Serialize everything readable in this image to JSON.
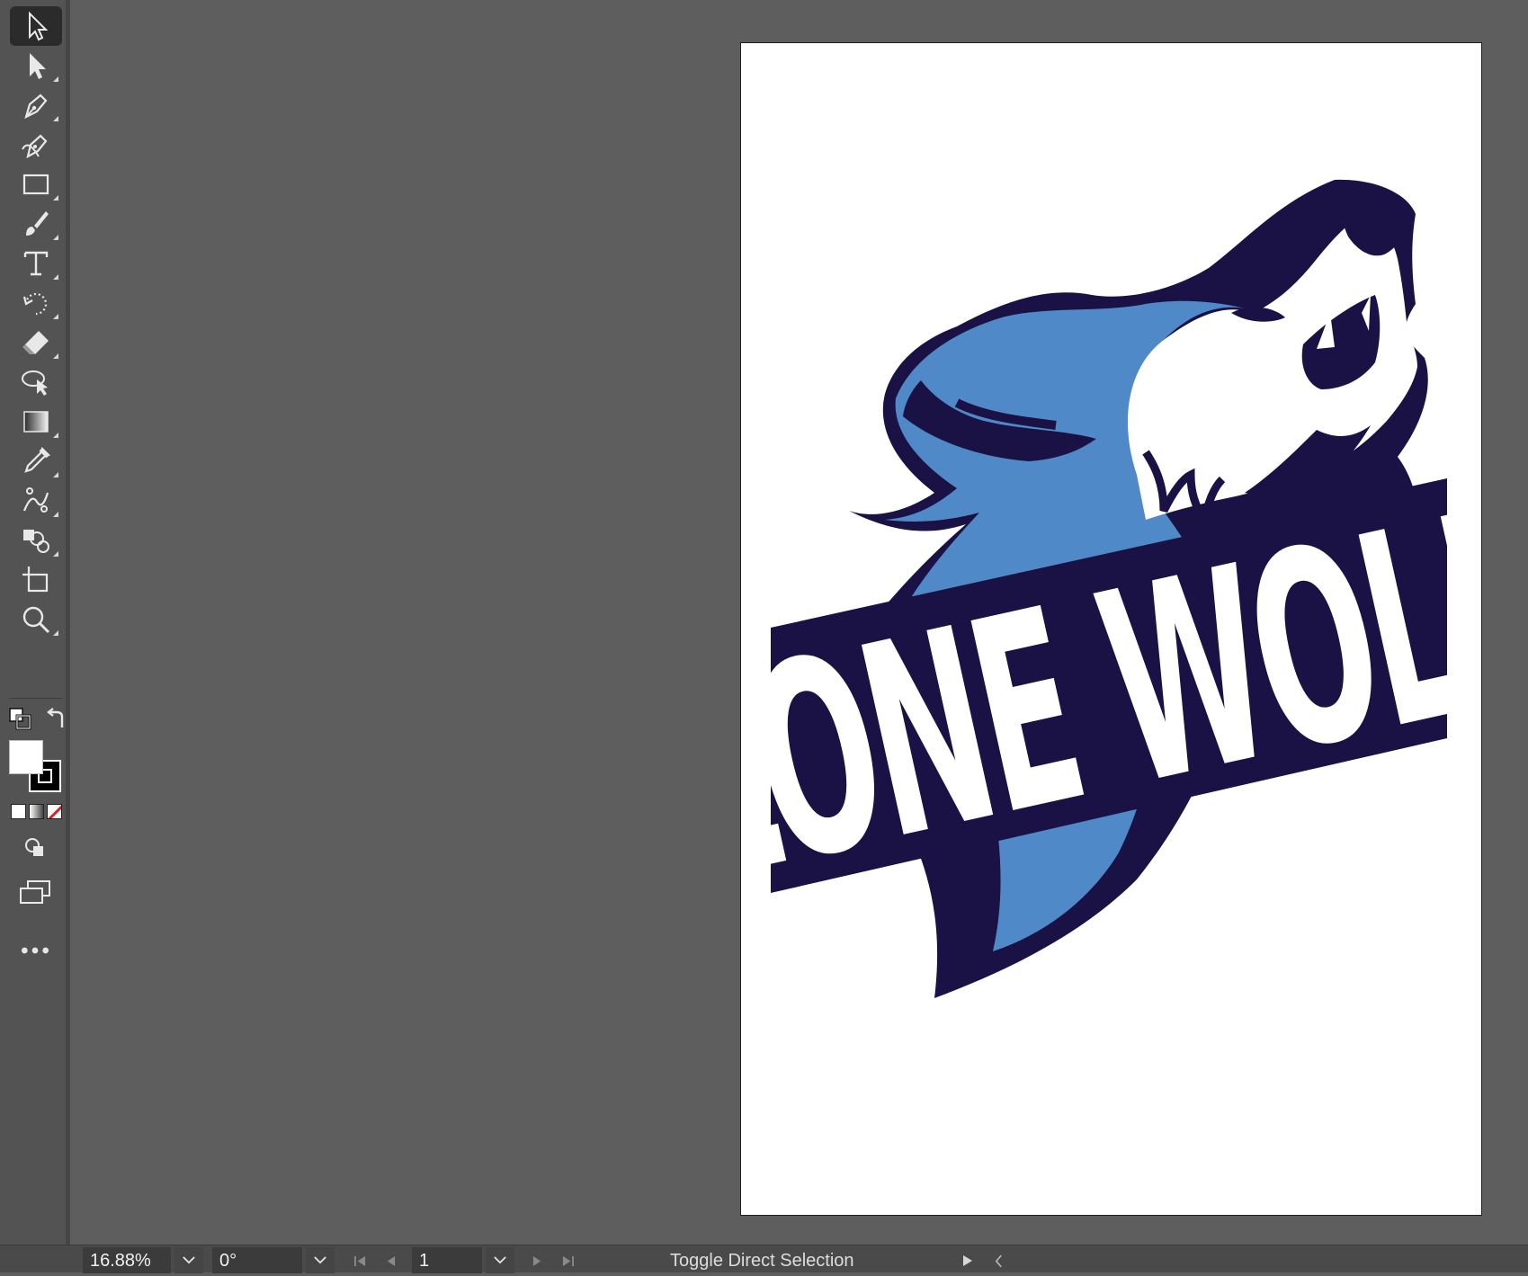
{
  "app": {
    "colors": {
      "toolbar_bg": "#535353",
      "canvas_bg": "#5e5e5e",
      "artboard_bg": "#ffffff",
      "navy": "#1a1245",
      "wolf_blue": "#5089c8",
      "white": "#ffffff"
    }
  },
  "toolbar": {
    "tools": [
      {
        "icon": "selection-tool-icon",
        "active": true
      },
      {
        "icon": "direct-selection-tool-icon"
      },
      {
        "icon": "pen-tool-icon"
      },
      {
        "icon": "curvature-tool-icon"
      },
      {
        "icon": "rectangle-tool-icon"
      },
      {
        "icon": "paintbrush-tool-icon"
      },
      {
        "icon": "type-tool-icon"
      },
      {
        "icon": "rotate-tool-icon"
      },
      {
        "icon": "eraser-tool-icon"
      },
      {
        "icon": "lasso-selection-tool-icon"
      },
      {
        "icon": "gradient-tool-icon"
      },
      {
        "icon": "eyedropper-tool-icon"
      },
      {
        "icon": "puppet-warp-tool-icon"
      },
      {
        "icon": "shape-builder-tool-icon"
      },
      {
        "icon": "artboard-tool-icon"
      },
      {
        "icon": "zoom-tool-icon"
      }
    ],
    "fill_color": "#ffffff",
    "stroke_color": "#000000"
  },
  "artwork": {
    "banner_text": "LONE WOLF"
  },
  "statusbar": {
    "zoom": "16.88%",
    "rotation": "0°",
    "artboard_number": "1",
    "status_text": "Toggle Direct Selection"
  }
}
